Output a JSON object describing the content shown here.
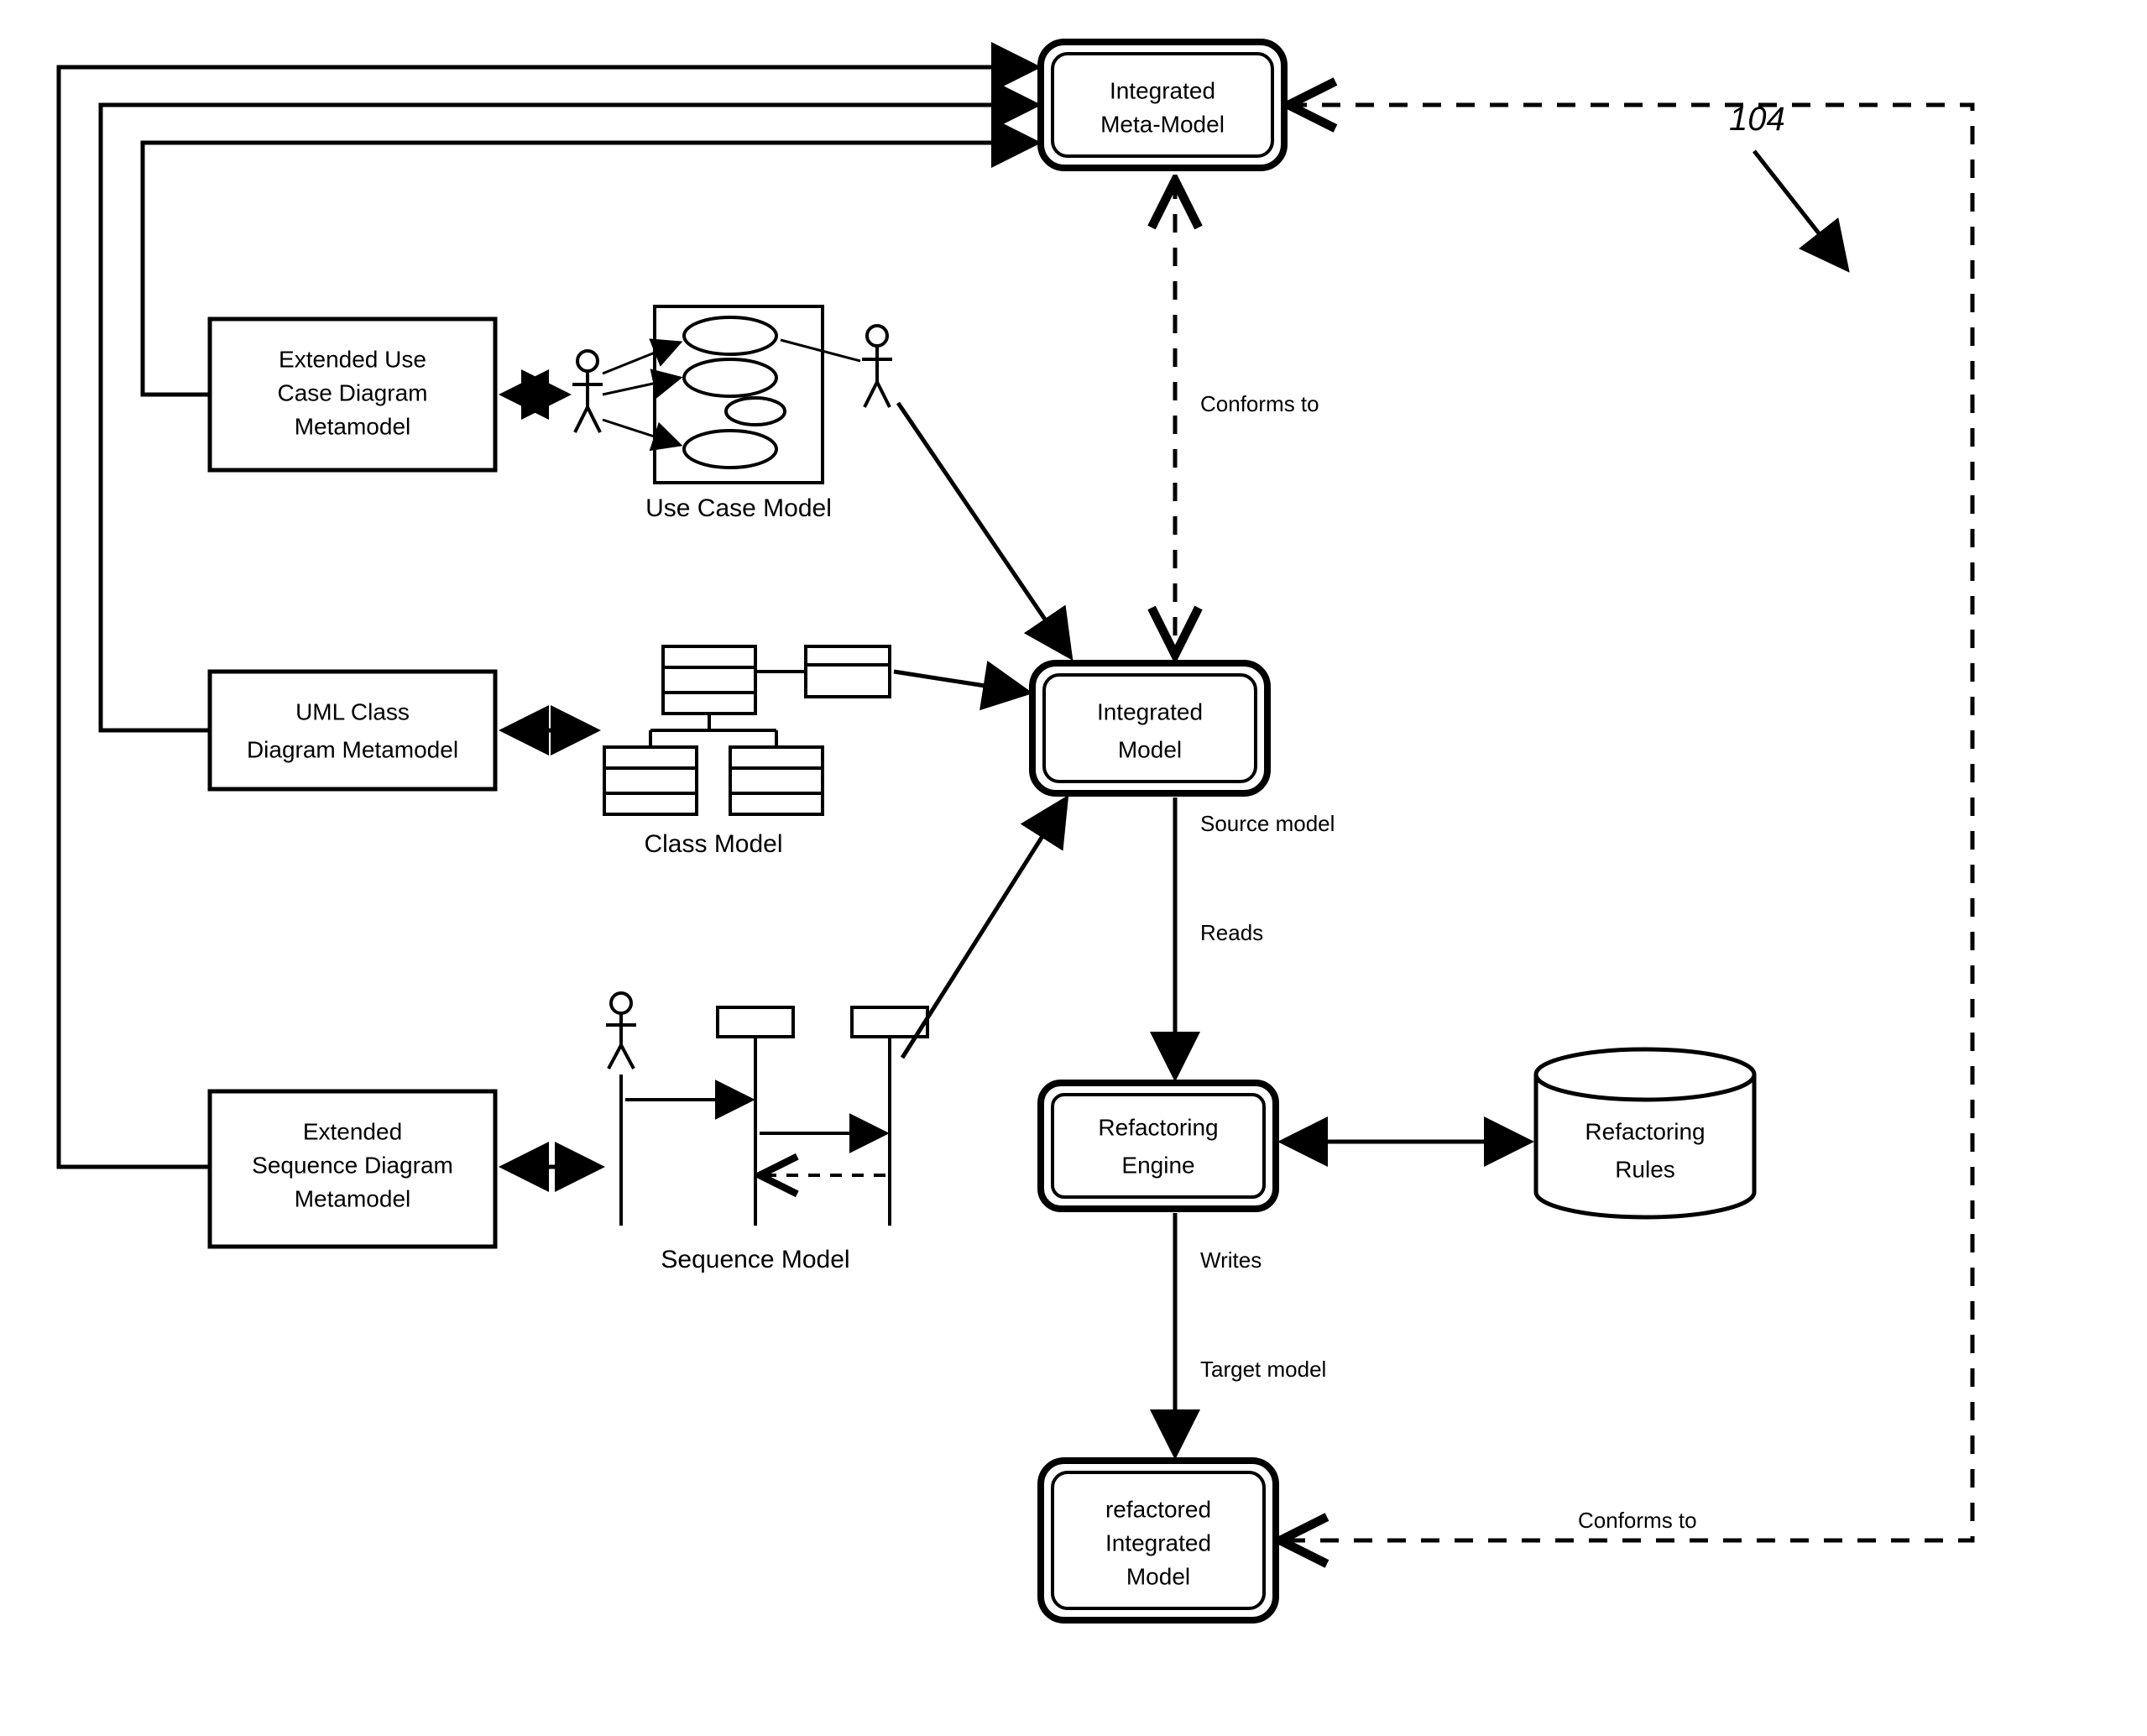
{
  "reference_number": "104",
  "nodes": {
    "integrated_meta_model": {
      "line1": "Integrated",
      "line2": "Meta-Model"
    },
    "extended_use_case_metamodel": {
      "line1": "Extended Use",
      "line2": "Case Diagram",
      "line3": "Metamodel"
    },
    "uml_class_metamodel": {
      "line1": "UML Class",
      "line2": "Diagram Metamodel"
    },
    "extended_sequence_metamodel": {
      "line1": "Extended",
      "line2": "Sequence Diagram",
      "line3": "Metamodel"
    },
    "integrated_model": {
      "line1": "Integrated",
      "line2": "Model"
    },
    "refactoring_engine": {
      "line1": "Refactoring",
      "line2": "Engine"
    },
    "refactoring_rules": {
      "line1": "Refactoring",
      "line2": "Rules"
    },
    "refactored_integrated_model": {
      "line1": "refactored",
      "line2": "Integrated",
      "line3": "Model"
    }
  },
  "captions": {
    "use_case_model": "Use Case Model",
    "class_model": "Class Model",
    "sequence_model": "Sequence Model"
  },
  "edge_labels": {
    "conforms_to_top": "Conforms to",
    "conforms_to_bottom": "Conforms to",
    "source_model": "Source model",
    "reads": "Reads",
    "writes": "Writes",
    "target_model": "Target model"
  }
}
